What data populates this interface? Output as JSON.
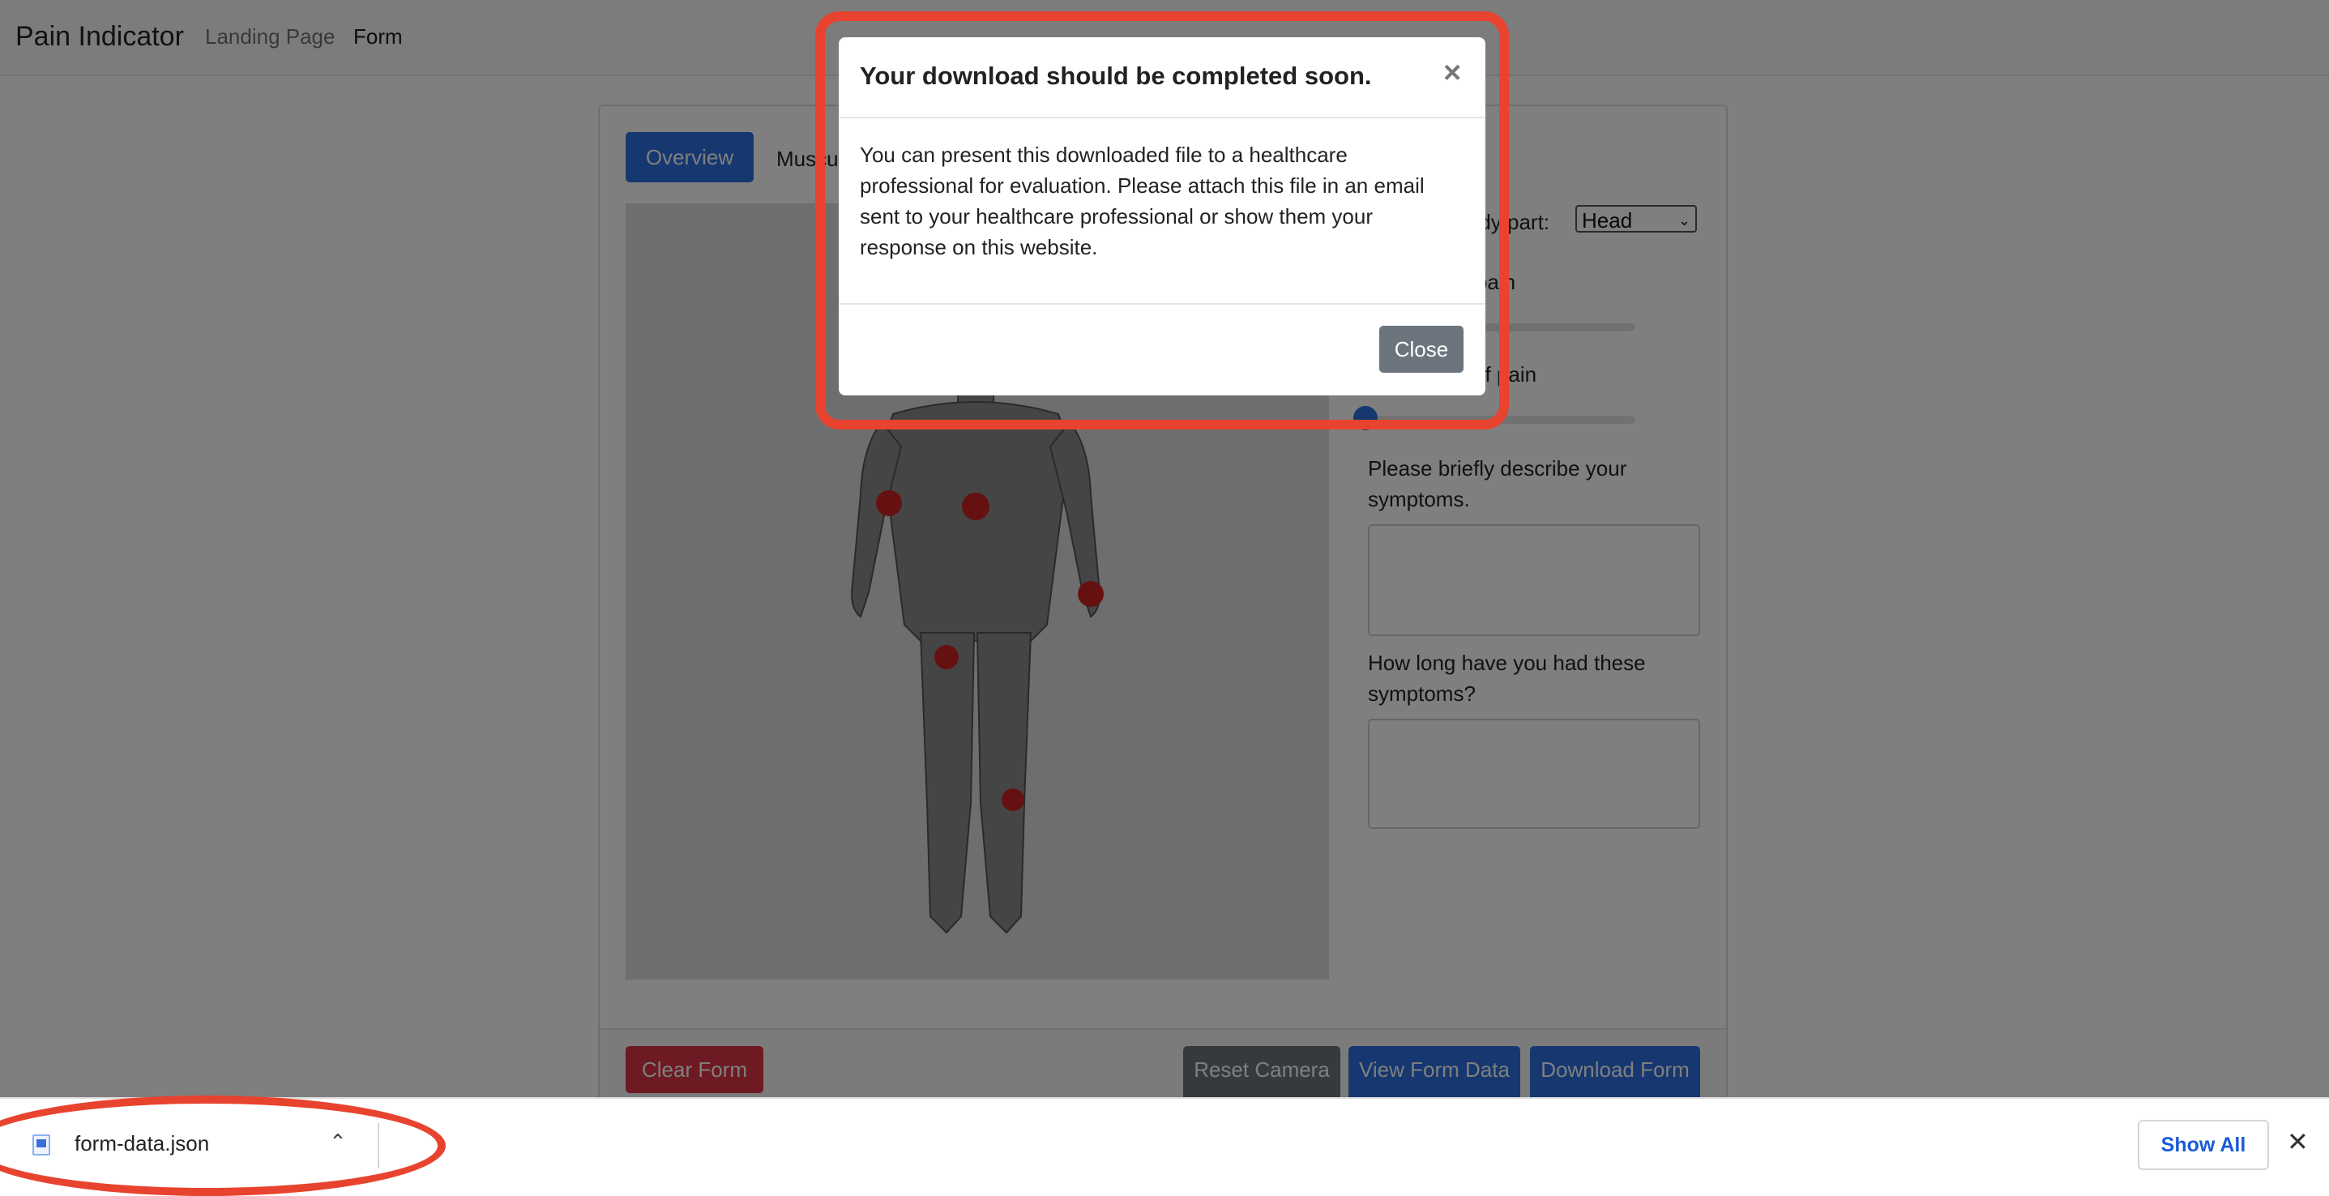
{
  "navbar": {
    "brand": "Pain Indicator",
    "links": [
      "Landing Page",
      "Form"
    ]
  },
  "tabs": [
    "Overview",
    "Musculoskeletal"
  ],
  "form": {
    "body_part_label": "Selected body part:",
    "body_part_value": "Head",
    "intensity_label": "Intensity of pain",
    "type_label": "Frequency of pain",
    "symptoms_label": "Please briefly describe your symptoms.",
    "duration_label": "How long have you had these symptoms?",
    "symptoms_value": "",
    "duration_value": ""
  },
  "buttons": {
    "clear": "Clear Form",
    "reset": "Reset Camera",
    "view": "View Form Data",
    "download": "Download Form"
  },
  "modal": {
    "title": "Your download should be completed soon.",
    "close_x": "×",
    "body": "You can present this downloaded file to a healthcare professional for evaluation. Please attach this file in an email sent to your healthcare professional or show them your response on this website.",
    "close_button": "Close"
  },
  "download_bar": {
    "file_name": "form-data.json",
    "show_all": "Show All",
    "close": "✕"
  },
  "colors": {
    "primary": "#2d6fde",
    "danger": "#dc3545",
    "secondary": "#6c757d",
    "annotation": "#e8432e",
    "pain_marker": "#cc2222"
  },
  "icons": [
    "file-icon",
    "chevron-up-icon",
    "close-icon",
    "chevron-down-icon"
  ]
}
